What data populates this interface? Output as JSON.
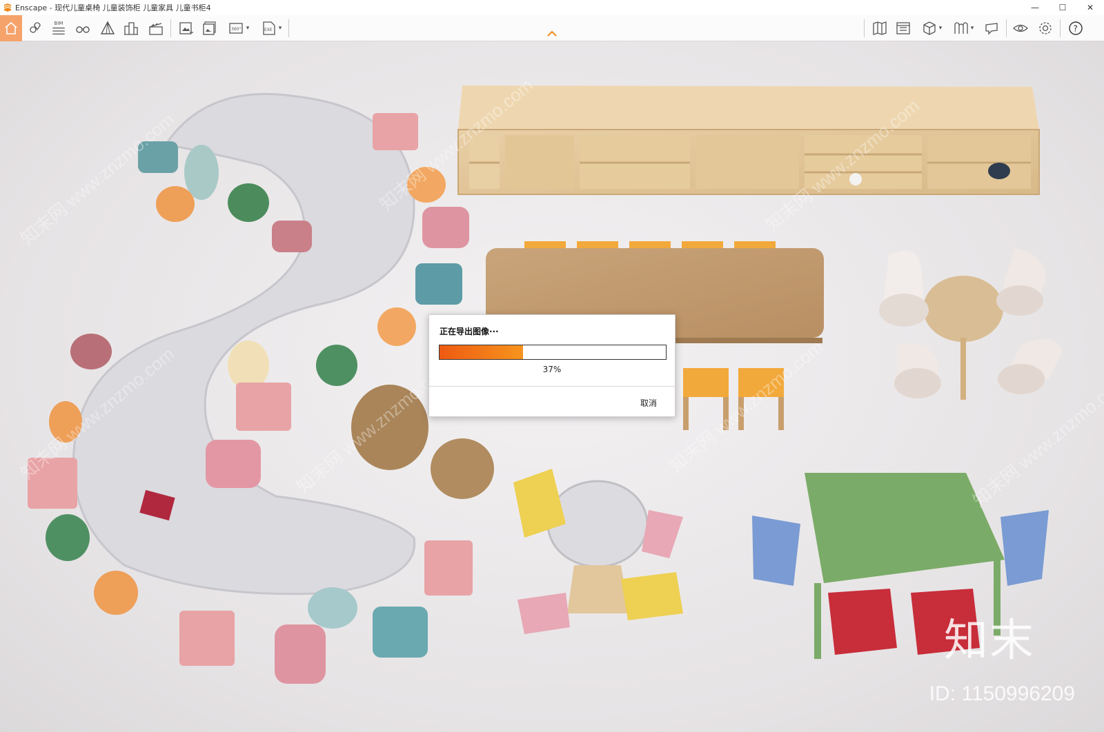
{
  "window": {
    "title": "Enscape - 现代儿童桌椅 儿童装饰柜 儿童家具 儿童书柜4",
    "controls": {
      "minimize": "—",
      "maximize": "☐",
      "close": "✕"
    }
  },
  "toolbar": {
    "left_tools": [
      "home-icon",
      "view-pins-icon",
      "bim-icon",
      "binoculars-icon",
      "perspective-icon",
      "buildings-icon",
      "clapperboard-icon"
    ],
    "export_tools": [
      "export-screenshot-icon",
      "batch-export-icon",
      "export-360-icon",
      "export-exe-icon"
    ],
    "right_tools": [
      "map-icon",
      "asset-library-icon",
      "cube-view-icon",
      "material-editor-icon",
      "feedback-icon",
      "visibility-icon",
      "settings-icon",
      "help-icon"
    ],
    "bim_label": "BIM",
    "pano_label": "360°",
    "exe_label": "EXE",
    "help_label": "?",
    "accent_color": "#f5a36a"
  },
  "export_dialog": {
    "title": "正在导出图像···",
    "progress": 0.37,
    "progress_text": "37%",
    "cancel_label": "取消",
    "fill_color": "#f07a1a"
  },
  "watermark": {
    "logo": "知末",
    "id": "ID: 1150996209",
    "repeat_text": "知末网 www.znzmo.com"
  }
}
